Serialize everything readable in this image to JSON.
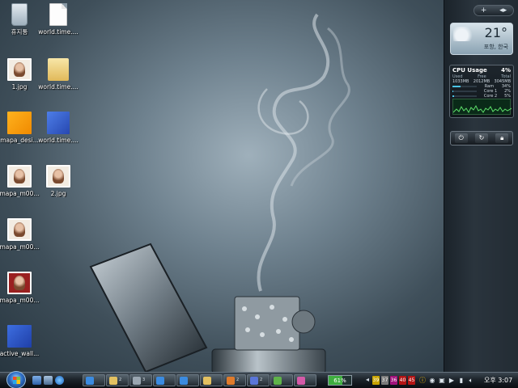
{
  "desktop": {
    "icons": [
      {
        "label": "휴지통",
        "icon": "recycle-bin-icon"
      },
      {
        "label": "world.time....",
        "icon": "document-icon"
      },
      {
        "label": "1.jpg",
        "icon": "photo-icon"
      },
      {
        "label": "world.time....",
        "icon": "folder-icon"
      },
      {
        "label": "mapa_desi...",
        "icon": "orange-image-icon"
      },
      {
        "label": "world.time....",
        "icon": "blue-image-icon"
      },
      {
        "label": "mapa_m00...",
        "icon": "photo-icon"
      },
      {
        "label": "2.jpg",
        "icon": "photo-icon"
      },
      {
        "label": "mapa_m00...",
        "icon": "photo-icon"
      },
      {
        "label": "mapa_m00...",
        "icon": "photo-icon"
      },
      {
        "label": "active_wall...",
        "icon": "blue-image-icon"
      }
    ]
  },
  "sidebar": {
    "controls": {
      "add": "+",
      "nav": "◂▸"
    },
    "weather": {
      "temperature": "21°",
      "location": "포항, 한국"
    },
    "cpu": {
      "title": "CPU Usage",
      "percent": "4%",
      "mem_headers": [
        "Used",
        "Free",
        "Total"
      ],
      "mem_values": [
        "1033MB",
        "2012MB",
        "3045MB"
      ],
      "ram_label": "Ram",
      "ram_percent": "34%",
      "ram_fill": 0.34,
      "cores": [
        {
          "label": "Core 1",
          "percent": "2%",
          "fill": 0.02
        },
        {
          "label": "Core 2",
          "percent": "5%",
          "fill": 0.05
        }
      ]
    },
    "power_buttons": [
      "power-icon",
      "restart-icon",
      "lock-icon"
    ]
  },
  "taskbar": {
    "quick_launch": [
      "show-desktop-icon",
      "switch-windows-icon",
      "ie-icon"
    ],
    "tasks": [
      {
        "count": "",
        "icon": "ie-icon",
        "color": "#3b8be0"
      },
      {
        "count": "2",
        "icon": "folder-icon",
        "color": "#e3c161"
      },
      {
        "count": "3",
        "icon": "calc-icon",
        "color": "#9aa6b1"
      },
      {
        "count": "",
        "icon": "ie-icon",
        "color": "#3b8be0"
      },
      {
        "count": "",
        "icon": "ie-icon",
        "color": "#3b8be0"
      },
      {
        "count": "",
        "icon": "folder-icon",
        "color": "#e3c161"
      },
      {
        "count": "2",
        "icon": "pencil-icon",
        "color": "#e07b2b"
      },
      {
        "count": "2",
        "icon": "app-icon",
        "color": "#5a76d8"
      },
      {
        "count": "",
        "icon": "music-icon",
        "color": "#5fb34a"
      },
      {
        "count": "",
        "icon": "image-icon",
        "color": "#d55aa8"
      }
    ],
    "battery": {
      "label": "61%",
      "fill": 0.61
    },
    "tray_numbers": [
      {
        "value": "39",
        "color": "#c9a400"
      },
      {
        "value": "37",
        "color": "#7b7b7b"
      },
      {
        "value": "36",
        "color": "#a3127c"
      },
      {
        "value": "40",
        "color": "#b31414"
      },
      {
        "value": "45",
        "color": "#b31414"
      }
    ],
    "tray_icons": [
      "info-icon",
      "antivirus-icon",
      "network-icon",
      "play-icon",
      "signal-icon",
      "volume-icon"
    ],
    "clock": "오후 3:07",
    "colors": {
      "accent": "#3fae3f"
    }
  }
}
